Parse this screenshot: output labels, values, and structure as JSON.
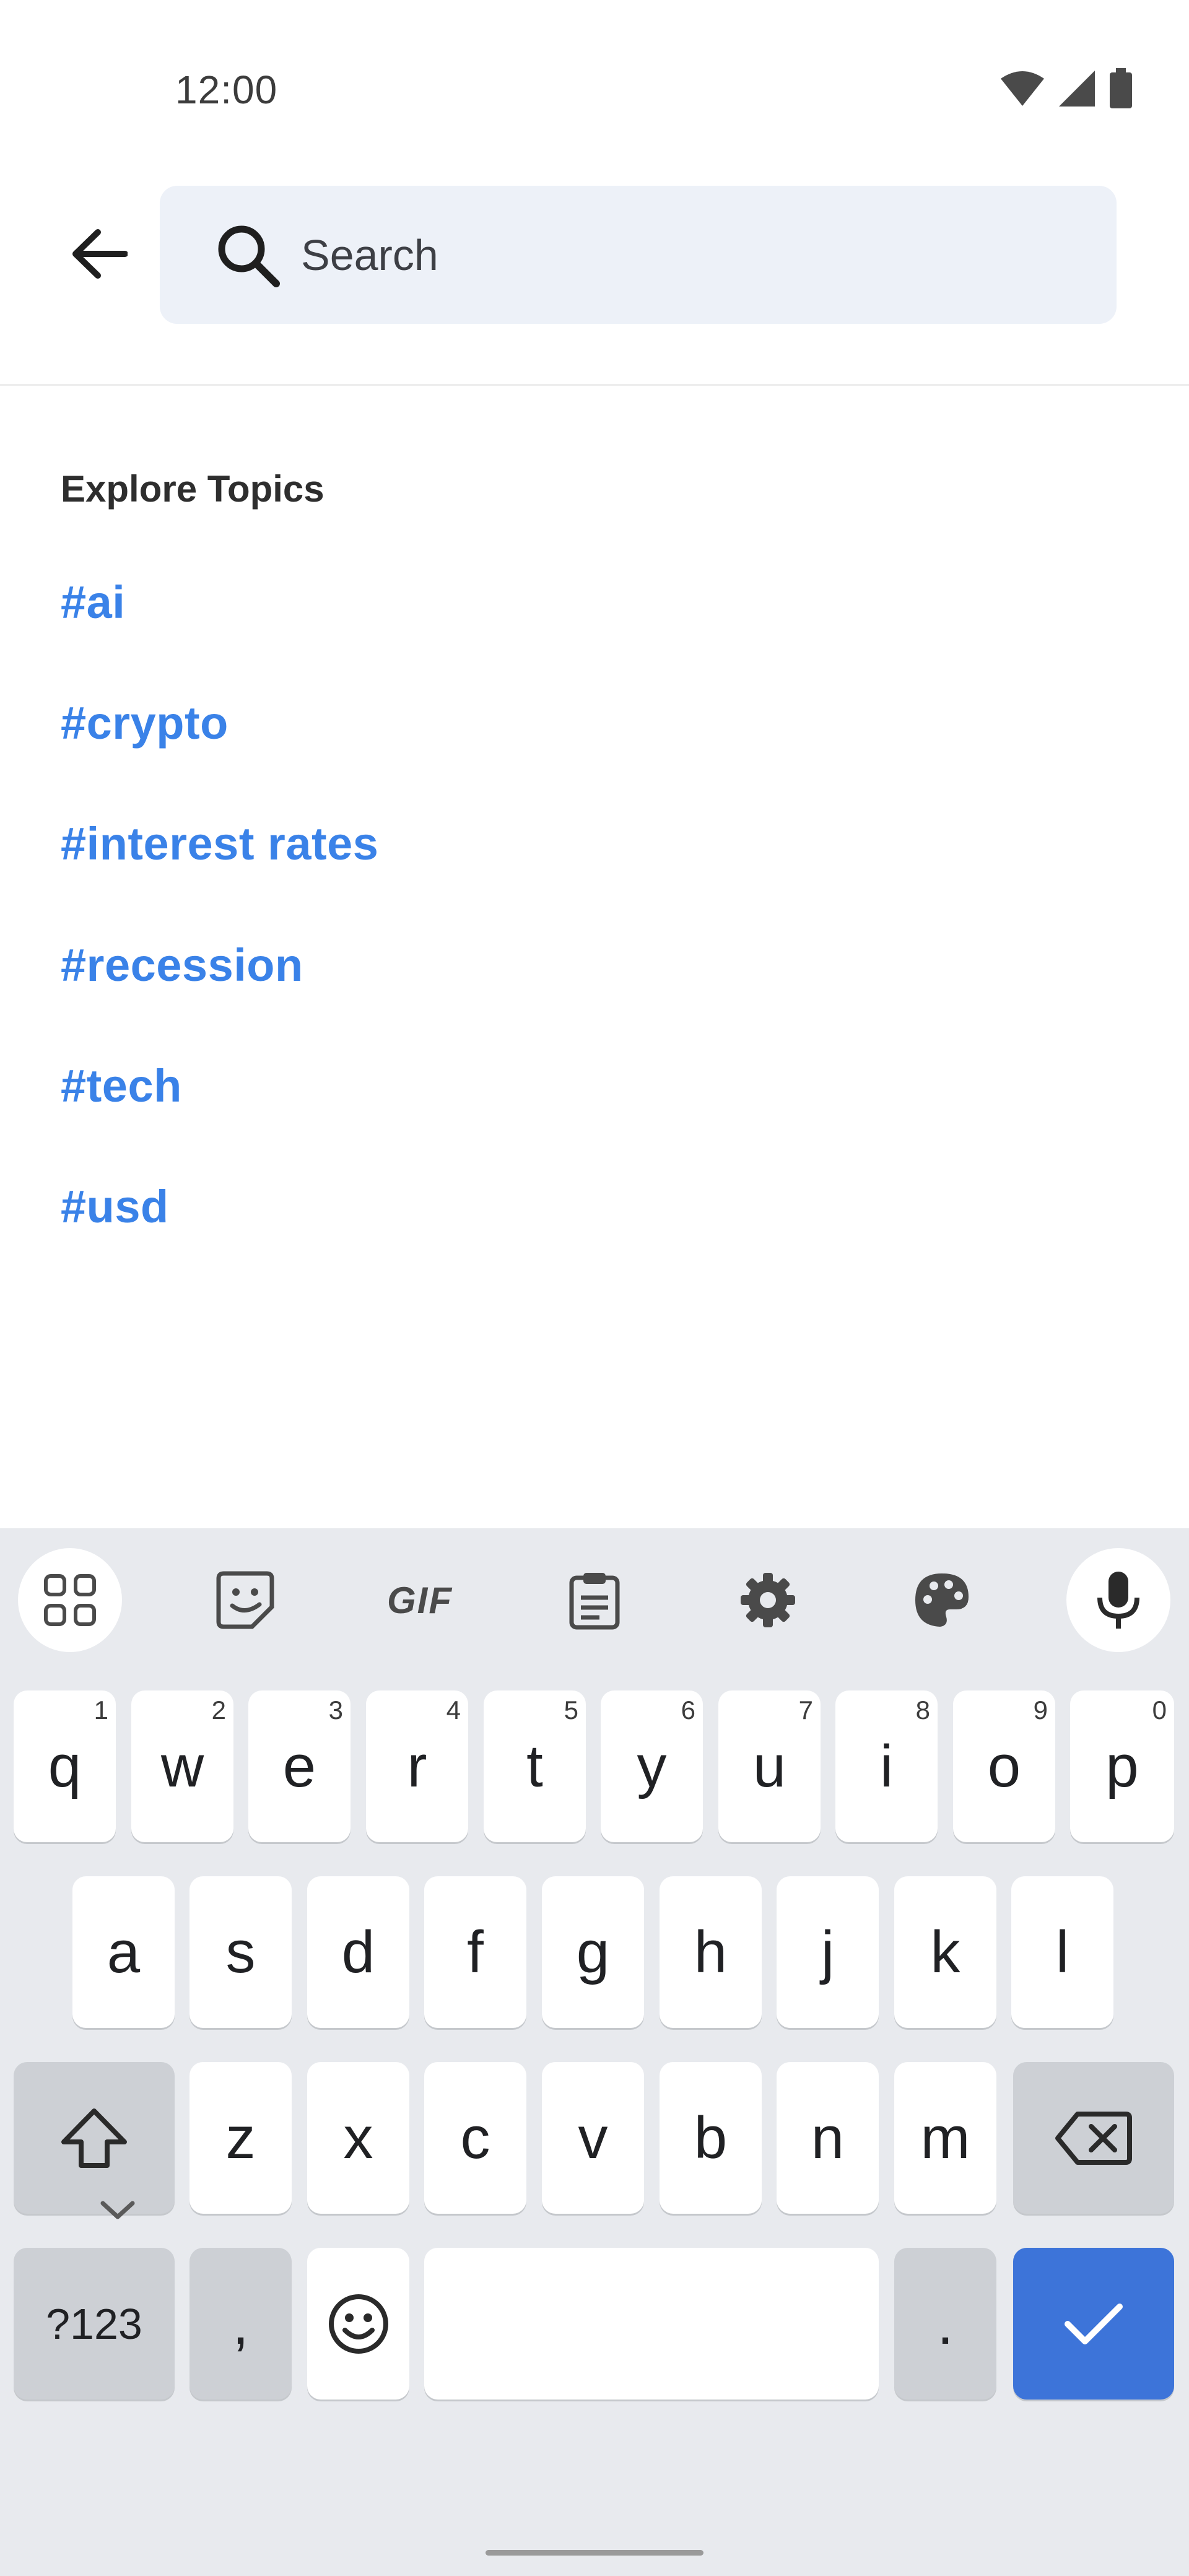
{
  "status_bar": {
    "time": "12:00",
    "icons": [
      "wifi-icon",
      "signal-icon",
      "battery-icon"
    ]
  },
  "header": {
    "back_icon": "arrow-left-icon",
    "search": {
      "placeholder": "Search",
      "value": "",
      "icon": "search-icon"
    }
  },
  "explore": {
    "title": "Explore Topics",
    "topics": [
      "#ai",
      "#crypto",
      "#interest rates",
      "#recession",
      "#tech",
      "#usd"
    ],
    "topic_color": "#3a82e8"
  },
  "keyboard": {
    "toolbar": [
      "apps-grid-icon",
      "sticker-icon",
      "gif-icon",
      "clipboard-icon",
      "settings-gear-icon",
      "palette-icon",
      "microphone-icon"
    ],
    "gif_label": "GIF",
    "row1": [
      {
        "key": "q",
        "hint": "1"
      },
      {
        "key": "w",
        "hint": "2"
      },
      {
        "key": "e",
        "hint": "3"
      },
      {
        "key": "r",
        "hint": "4"
      },
      {
        "key": "t",
        "hint": "5"
      },
      {
        "key": "y",
        "hint": "6"
      },
      {
        "key": "u",
        "hint": "7"
      },
      {
        "key": "i",
        "hint": "8"
      },
      {
        "key": "o",
        "hint": "9"
      },
      {
        "key": "p",
        "hint": "0"
      }
    ],
    "row2": [
      "a",
      "s",
      "d",
      "f",
      "g",
      "h",
      "j",
      "k",
      "l"
    ],
    "row3": [
      "z",
      "x",
      "c",
      "v",
      "b",
      "n",
      "m"
    ],
    "bottom": {
      "symbols": "?123",
      "comma": ",",
      "period": "."
    },
    "accent_color": "#3d74d9"
  }
}
